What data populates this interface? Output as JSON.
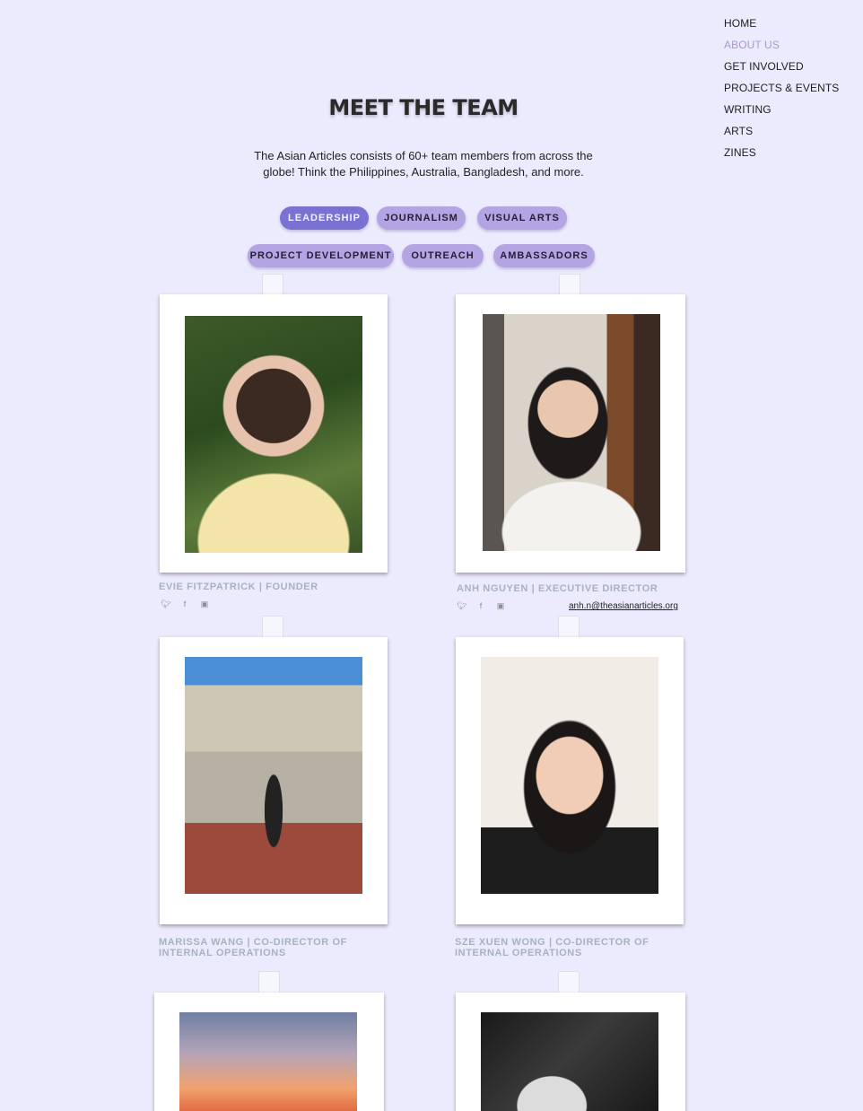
{
  "nav": {
    "items": [
      "HOME",
      "ABOUT US",
      "GET INVOLVED",
      "PROJECTS & EVENTS",
      "WRITING",
      "ARTS",
      "ZINES"
    ],
    "active": "ABOUT US"
  },
  "header": {
    "title": "MEET THE TEAM",
    "intro": "The Asian Articles consists of 60+ team members from across the globe! Think the Philippines, Australia, Bangladesh, and more."
  },
  "filters": [
    "LEADERSHIP",
    "JOURNALISM",
    "VISUAL ARTS",
    "PROJECT DEVELOPMENT",
    "OUTREACH",
    "AMBASSADORS"
  ],
  "active_filter": "LEADERSHIP",
  "members": [
    {
      "caption": "EVIE FITZPATRICK  |  FOUNDER",
      "socials": [
        "twitter-icon",
        "facebook-icon",
        "instagram-icon"
      ]
    },
    {
      "caption": "ANH NGUYEN  |  EXECUTIVE DIRECTOR",
      "socials": [
        "twitter-icon",
        "facebook-icon",
        "instagram-icon"
      ],
      "email": "anh.n@theasianarticles.org"
    },
    {
      "caption": "MARISSA WANG |  CO-DIRECTOR OF INTERNAL OPERATIONS"
    },
    {
      "caption": "SZE XUEN WONG |  CO-DIRECTOR OF INTERNAL OPERATIONS"
    },
    {
      "caption": ""
    },
    {
      "caption": ""
    }
  ],
  "colors": {
    "background": "#ecebfd",
    "pill": "#b5a4e3",
    "pill_active": "#7a72d3",
    "nav_active": "#a996d8",
    "caption": "#a6b2c2"
  }
}
